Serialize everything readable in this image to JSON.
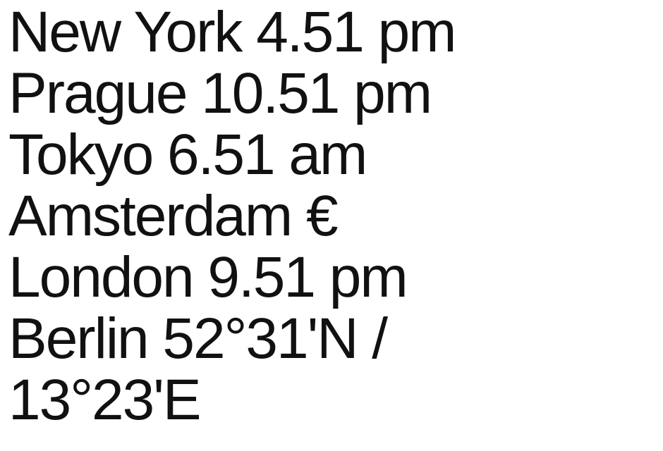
{
  "lines": [
    "New York 4.51 pm",
    "Prague 10.51 pm",
    "Tokyo 6.51 am",
    "Amsterdam €",
    "London 9.51 pm",
    "Berlin 52°31'N /",
    "13°23'E"
  ]
}
